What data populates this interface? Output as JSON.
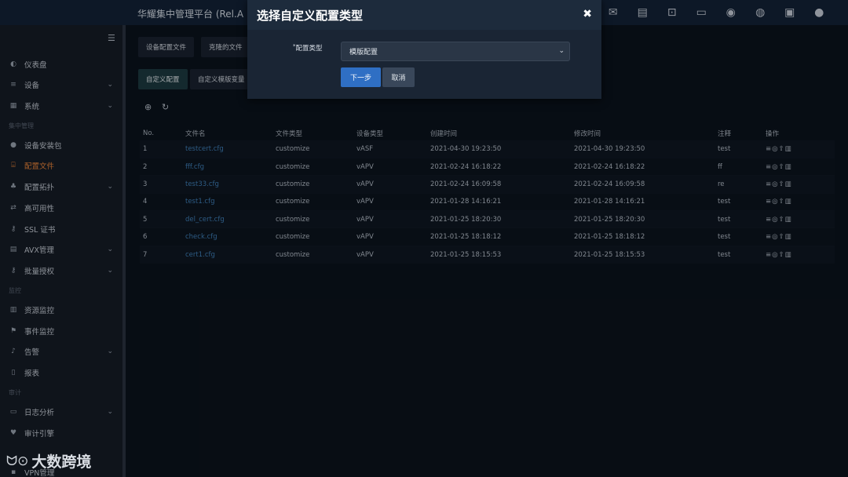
{
  "topbar": {
    "title": "华耀集中管理平台 (Rel.A",
    "icons": [
      "mail-icon",
      "document-icon",
      "terminal-icon",
      "monitor-icon",
      "compass-icon",
      "globe-icon",
      "save-icon",
      "user-icon"
    ]
  },
  "sidebar": {
    "items": [
      {
        "label": "仪表盘",
        "icon": "dashboard-icon"
      },
      {
        "label": "设备",
        "icon": "list-icon"
      },
      {
        "label": "系统",
        "icon": "system-icon"
      },
      {
        "label": "设备安装包",
        "icon": "package-icon"
      },
      {
        "label": "配置文件",
        "icon": "config-file-icon"
      },
      {
        "label": "配置拓扑",
        "icon": "topology-icon"
      },
      {
        "label": "高可用性",
        "icon": "ha-icon"
      },
      {
        "label": "SSL 证书",
        "icon": "key-icon"
      },
      {
        "label": "AVX管理",
        "icon": "avx-icon"
      },
      {
        "label": "批量授权",
        "icon": "key-icon"
      },
      {
        "label": "资源监控",
        "icon": "resource-icon"
      },
      {
        "label": "事件监控",
        "icon": "flag-icon"
      },
      {
        "label": "告警",
        "icon": "bell-icon"
      },
      {
        "label": "报表",
        "icon": "report-icon"
      },
      {
        "label": "日志分析",
        "icon": "log-icon"
      },
      {
        "label": "审计引擎",
        "icon": "audit-icon"
      },
      {
        "label": "VPN管理",
        "icon": "vpn-icon"
      }
    ],
    "sections": [
      "集中管理",
      "监控",
      "审计"
    ]
  },
  "main": {
    "tabs_row1": [
      "设备配置文件",
      "克隆的文件"
    ],
    "tabs_row2": [
      "自定义配置",
      "自定义模版变量"
    ],
    "table": {
      "headers": [
        "No.",
        "文件名",
        "文件类型",
        "设备类型",
        "创建时间",
        "修改时间",
        "注释",
        "操作"
      ],
      "rows": [
        [
          "1",
          "testcert.cfg",
          "customize",
          "vASF",
          "2021-04-30 19:23:50",
          "2021-04-30 19:23:50",
          "test"
        ],
        [
          "2",
          "fff.cfg",
          "customize",
          "vAPV",
          "2021-02-24 16:18:22",
          "2021-02-24 16:18:22",
          "ff"
        ],
        [
          "3",
          "test33.cfg",
          "customize",
          "vAPV",
          "2021-02-24 16:09:58",
          "2021-02-24 16:09:58",
          "re"
        ],
        [
          "4",
          "test1.cfg",
          "customize",
          "vAPV",
          "2021-01-28 14:16:21",
          "2021-01-28 14:16:21",
          "test"
        ],
        [
          "5",
          "del_cert.cfg",
          "customize",
          "vAPV",
          "2021-01-25 18:20:30",
          "2021-01-25 18:20:30",
          "test"
        ],
        [
          "6",
          "check.cfg",
          "customize",
          "vAPV",
          "2021-01-25 18:18:12",
          "2021-01-25 18:18:12",
          "test"
        ],
        [
          "7",
          "cert1.cfg",
          "customize",
          "vAPV",
          "2021-01-25 18:15:53",
          "2021-01-25 18:15:53",
          "test"
        ]
      ]
    }
  },
  "modal": {
    "title": "选择自定义配置类型",
    "field_label": "配置类型",
    "select_value": "模版配置",
    "next_label": "下一步",
    "cancel_label": "取消"
  },
  "watermark": {
    "text": "大数跨境"
  }
}
